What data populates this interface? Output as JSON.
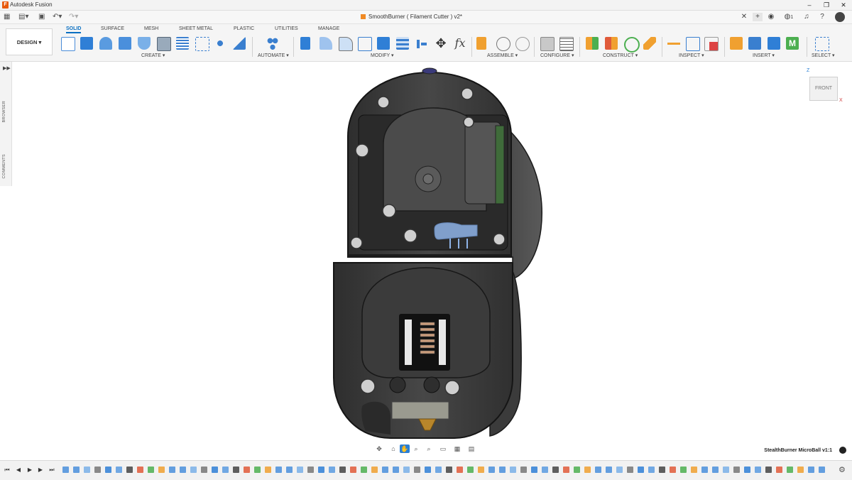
{
  "window": {
    "app_title": "Autodesk Fusion",
    "logo_letter": "F"
  },
  "document_tab": {
    "label": "SmoothBurner ( Filament Cutter ) v2*"
  },
  "workspace": {
    "label": "DESIGN ▾"
  },
  "ws_tabs": [
    {
      "label": "SOLID",
      "active": true
    },
    {
      "label": "SURFACE",
      "active": false
    },
    {
      "label": "MESH",
      "active": false
    },
    {
      "label": "SHEET METAL",
      "active": false
    },
    {
      "label": "PLASTIC",
      "active": false
    },
    {
      "label": "UTILITIES",
      "active": false
    },
    {
      "label": "MANAGE",
      "active": false
    }
  ],
  "groups": [
    "CREATE ▾",
    "AUTOMATE ▾",
    "MODIFY ▾",
    "ASSEMBLE ▾",
    "CONFIGURE ▾",
    "CONSTRUCT ▾",
    "INSPECT ▾",
    "INSERT ▾",
    "SELECT ▾"
  ],
  "side_panel": {
    "browser": "BROWSER",
    "comments": "COMMENTS"
  },
  "viewcube": {
    "face": "FRONT",
    "z": "Z",
    "x": "X"
  },
  "footer": {
    "design_name": "StealthBurner MicroBall v1:1"
  },
  "tab_bar": {
    "user_count": "1"
  },
  "colors": {
    "accent": "#0a6fc2",
    "part_body": "#3e3e3e",
    "highlight": "#8fb4e8",
    "nozzle": "#b8862b"
  }
}
